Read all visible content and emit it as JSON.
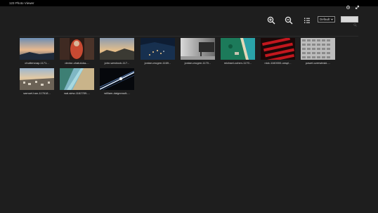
{
  "window": {
    "title": "123 Photo Viewer",
    "icons": [
      "settings-icon",
      "fullscreen-icon"
    ]
  },
  "toolbar": {
    "zoom_in_icon": "zoom-in-icon",
    "zoom_out_icon": "zoom-out-icon",
    "list_view_icon": "list-view-icon",
    "sort_select": {
      "value": "Default"
    },
    "search": {
      "value": "",
      "icon": "search-icon"
    }
  },
  "gallery": {
    "photos": [
      {
        "caption": "chuttersnap-1171..."
      },
      {
        "caption": "dextor-chatuluka-..."
      },
      {
        "caption": "john-westrock-117..."
      },
      {
        "caption": "jordan-mcgee-1169..."
      },
      {
        "caption": "jordan-mcgee-1170..."
      },
      {
        "caption": "michael-cohen-1170..."
      },
      {
        "caption": "nick-1160000-unspl..."
      },
      {
        "caption": "pawel-czerwinski-..."
      },
      {
        "caption": "samuel-han-117618..."
      },
      {
        "caption": "wai-siew-1162789-..."
      },
      {
        "caption": "william-daigneault-..."
      }
    ]
  }
}
